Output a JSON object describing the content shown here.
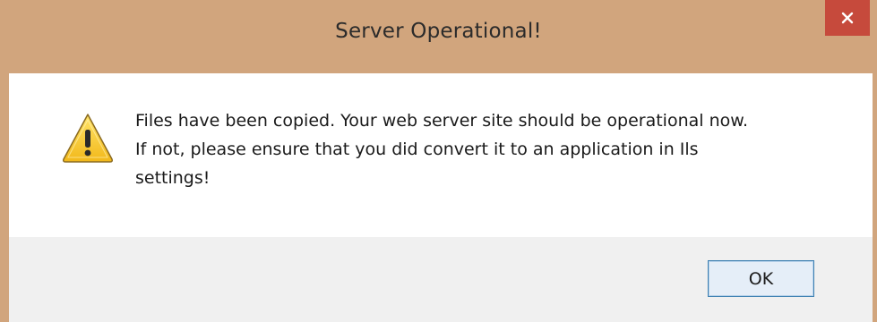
{
  "window": {
    "title": "Server Operational!",
    "close_icon": "close-icon",
    "frame_color": "#d1a57d",
    "close_color": "#c64a3c"
  },
  "dialog": {
    "icon": "warning-icon",
    "message_lines": [
      "Files have been copied. Your web server site should be operational now.",
      "If not, please ensure that you did convert it to an application in Ils",
      "settings!"
    ],
    "ok_label": "OK"
  }
}
